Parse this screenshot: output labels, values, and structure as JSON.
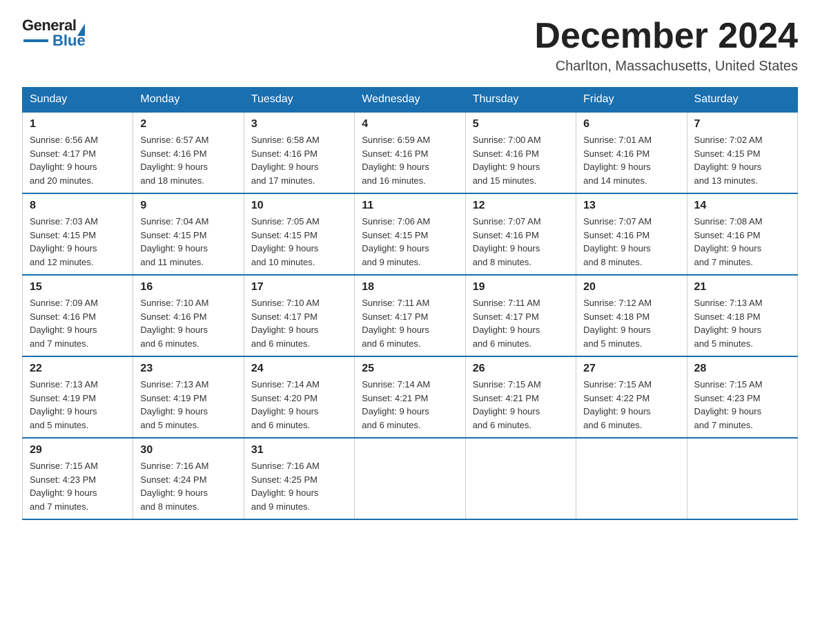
{
  "logo": {
    "text_general": "General",
    "text_blue": "Blue"
  },
  "title": "December 2024",
  "subtitle": "Charlton, Massachusetts, United States",
  "weekdays": [
    "Sunday",
    "Monday",
    "Tuesday",
    "Wednesday",
    "Thursday",
    "Friday",
    "Saturday"
  ],
  "weeks": [
    [
      {
        "day": "1",
        "info": "Sunrise: 6:56 AM\nSunset: 4:17 PM\nDaylight: 9 hours\nand 20 minutes."
      },
      {
        "day": "2",
        "info": "Sunrise: 6:57 AM\nSunset: 4:16 PM\nDaylight: 9 hours\nand 18 minutes."
      },
      {
        "day": "3",
        "info": "Sunrise: 6:58 AM\nSunset: 4:16 PM\nDaylight: 9 hours\nand 17 minutes."
      },
      {
        "day": "4",
        "info": "Sunrise: 6:59 AM\nSunset: 4:16 PM\nDaylight: 9 hours\nand 16 minutes."
      },
      {
        "day": "5",
        "info": "Sunrise: 7:00 AM\nSunset: 4:16 PM\nDaylight: 9 hours\nand 15 minutes."
      },
      {
        "day": "6",
        "info": "Sunrise: 7:01 AM\nSunset: 4:16 PM\nDaylight: 9 hours\nand 14 minutes."
      },
      {
        "day": "7",
        "info": "Sunrise: 7:02 AM\nSunset: 4:15 PM\nDaylight: 9 hours\nand 13 minutes."
      }
    ],
    [
      {
        "day": "8",
        "info": "Sunrise: 7:03 AM\nSunset: 4:15 PM\nDaylight: 9 hours\nand 12 minutes."
      },
      {
        "day": "9",
        "info": "Sunrise: 7:04 AM\nSunset: 4:15 PM\nDaylight: 9 hours\nand 11 minutes."
      },
      {
        "day": "10",
        "info": "Sunrise: 7:05 AM\nSunset: 4:15 PM\nDaylight: 9 hours\nand 10 minutes."
      },
      {
        "day": "11",
        "info": "Sunrise: 7:06 AM\nSunset: 4:15 PM\nDaylight: 9 hours\nand 9 minutes."
      },
      {
        "day": "12",
        "info": "Sunrise: 7:07 AM\nSunset: 4:16 PM\nDaylight: 9 hours\nand 8 minutes."
      },
      {
        "day": "13",
        "info": "Sunrise: 7:07 AM\nSunset: 4:16 PM\nDaylight: 9 hours\nand 8 minutes."
      },
      {
        "day": "14",
        "info": "Sunrise: 7:08 AM\nSunset: 4:16 PM\nDaylight: 9 hours\nand 7 minutes."
      }
    ],
    [
      {
        "day": "15",
        "info": "Sunrise: 7:09 AM\nSunset: 4:16 PM\nDaylight: 9 hours\nand 7 minutes."
      },
      {
        "day": "16",
        "info": "Sunrise: 7:10 AM\nSunset: 4:16 PM\nDaylight: 9 hours\nand 6 minutes."
      },
      {
        "day": "17",
        "info": "Sunrise: 7:10 AM\nSunset: 4:17 PM\nDaylight: 9 hours\nand 6 minutes."
      },
      {
        "day": "18",
        "info": "Sunrise: 7:11 AM\nSunset: 4:17 PM\nDaylight: 9 hours\nand 6 minutes."
      },
      {
        "day": "19",
        "info": "Sunrise: 7:11 AM\nSunset: 4:17 PM\nDaylight: 9 hours\nand 6 minutes."
      },
      {
        "day": "20",
        "info": "Sunrise: 7:12 AM\nSunset: 4:18 PM\nDaylight: 9 hours\nand 5 minutes."
      },
      {
        "day": "21",
        "info": "Sunrise: 7:13 AM\nSunset: 4:18 PM\nDaylight: 9 hours\nand 5 minutes."
      }
    ],
    [
      {
        "day": "22",
        "info": "Sunrise: 7:13 AM\nSunset: 4:19 PM\nDaylight: 9 hours\nand 5 minutes."
      },
      {
        "day": "23",
        "info": "Sunrise: 7:13 AM\nSunset: 4:19 PM\nDaylight: 9 hours\nand 5 minutes."
      },
      {
        "day": "24",
        "info": "Sunrise: 7:14 AM\nSunset: 4:20 PM\nDaylight: 9 hours\nand 6 minutes."
      },
      {
        "day": "25",
        "info": "Sunrise: 7:14 AM\nSunset: 4:21 PM\nDaylight: 9 hours\nand 6 minutes."
      },
      {
        "day": "26",
        "info": "Sunrise: 7:15 AM\nSunset: 4:21 PM\nDaylight: 9 hours\nand 6 minutes."
      },
      {
        "day": "27",
        "info": "Sunrise: 7:15 AM\nSunset: 4:22 PM\nDaylight: 9 hours\nand 6 minutes."
      },
      {
        "day": "28",
        "info": "Sunrise: 7:15 AM\nSunset: 4:23 PM\nDaylight: 9 hours\nand 7 minutes."
      }
    ],
    [
      {
        "day": "29",
        "info": "Sunrise: 7:15 AM\nSunset: 4:23 PM\nDaylight: 9 hours\nand 7 minutes."
      },
      {
        "day": "30",
        "info": "Sunrise: 7:16 AM\nSunset: 4:24 PM\nDaylight: 9 hours\nand 8 minutes."
      },
      {
        "day": "31",
        "info": "Sunrise: 7:16 AM\nSunset: 4:25 PM\nDaylight: 9 hours\nand 9 minutes."
      },
      {
        "day": "",
        "info": ""
      },
      {
        "day": "",
        "info": ""
      },
      {
        "day": "",
        "info": ""
      },
      {
        "day": "",
        "info": ""
      }
    ]
  ]
}
